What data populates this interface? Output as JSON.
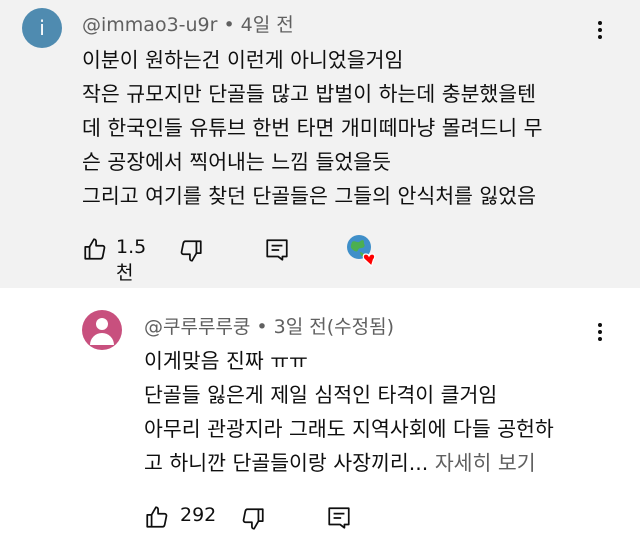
{
  "comments": [
    {
      "avatar_letter": "i",
      "author": "@immao3-u9r",
      "separator": "•",
      "time": "4일 전",
      "lines": [
        "이분이 원하는건 이런게 아니었을거임",
        "작은 규모지만 단골들 많고 밥벌이 하는데 충분했을텐",
        "데 한국인들 유튜브 한번 타면 개미떼마냥 몰려드니 무",
        "슨 공장에서 찍어내는 느낌 들었을듯",
        "그리고 여기를 찾던 단골들은 그들의 안식처를 잃었음"
      ],
      "likes": "1.5천",
      "icons": [
        "thumb-up-icon",
        "thumb-down-icon",
        "reply-icon",
        "creator-heart-icon",
        "kebab-menu-icon"
      ],
      "colors": {
        "background": "#f2f2f2",
        "avatar": "#4f8bb0"
      }
    },
    {
      "author": "@쿠루루루쿵",
      "separator": "•",
      "time": "3일 전(수정됨)",
      "lines": [
        "이게맞음 진짜 ㅠㅠ",
        "단골들 잃은게 제일 심적인 타격이 클거임",
        "아무리 관광지라 그래도 지역사회에 다들 공헌하",
        "고 하니깐 단골들이랑 사장끼리..."
      ],
      "read_more": "자세히 보기",
      "likes": "292",
      "icons": [
        "thumb-up-icon",
        "thumb-down-icon",
        "reply-icon",
        "kebab-menu-icon"
      ],
      "colors": {
        "background": "#ffffff",
        "avatar": "#c8507e"
      }
    }
  ]
}
